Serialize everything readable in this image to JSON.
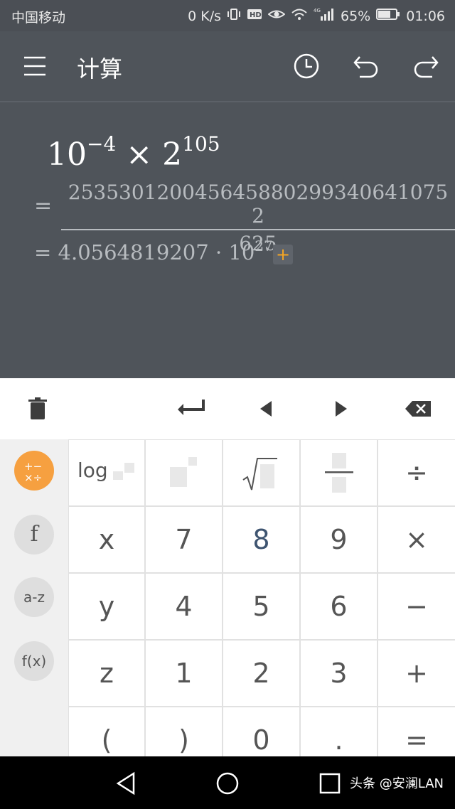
{
  "status_bar": {
    "carrier": "中国移动",
    "network_speed": "0 K/s",
    "battery": "65%",
    "time": "01:06",
    "icons": [
      "vibrate-icon",
      "hd-icon",
      "eye-icon",
      "wifi-icon",
      "signal-4g-icon",
      "battery-icon"
    ]
  },
  "app_bar": {
    "title": "计算",
    "icons": [
      "menu-icon",
      "history-icon",
      "undo-icon",
      "redo-icon"
    ]
  },
  "display": {
    "expression": {
      "base1": "10",
      "exp1": "−4",
      "op": "×",
      "base2": "2",
      "exp2": "105"
    },
    "result_fraction": {
      "eq": "=",
      "numerator": "253530120045645880299340641075​2",
      "denominator": "625"
    },
    "result_decimal": {
      "eq": "=",
      "mantissa": "4.0564819207",
      "dot": "·",
      "base": "10",
      "exp": "27"
    },
    "more_label": "+"
  },
  "toolbar": {
    "icons": [
      "trash-icon",
      "enter-icon",
      "left-arrow-icon",
      "right-arrow-icon",
      "backspace-icon"
    ]
  },
  "left_tabs": [
    {
      "label": "+−×÷",
      "active": true
    },
    {
      "label": "f",
      "active": false
    },
    {
      "label": "a-z",
      "active": false
    },
    {
      "label": "f(x)",
      "active": false
    }
  ],
  "keypad": {
    "rows": [
      [
        "log",
        "power-template",
        "sqrt-template",
        "fraction-template",
        "÷"
      ],
      [
        "x",
        "7",
        "8",
        "9",
        "×"
      ],
      [
        "y",
        "4",
        "5",
        "6",
        "−"
      ],
      [
        "z",
        "1",
        "2",
        "3",
        "+"
      ],
      [
        "(",
        ")",
        "0",
        ".",
        "="
      ]
    ]
  },
  "nav_bar": {
    "icons": [
      "back-icon",
      "home-icon",
      "recents-icon"
    ],
    "watermark": "头条 @安澜LAN"
  }
}
